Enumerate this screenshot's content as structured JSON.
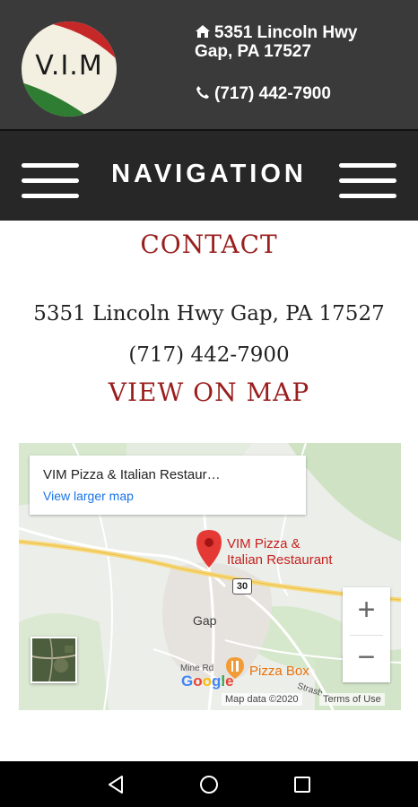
{
  "header": {
    "logo_text": "V.I.M",
    "address_line1": "5351 Lincoln Hwy",
    "address_line2": "Gap, PA 17527",
    "phone": "(717) 442-7900"
  },
  "nav": {
    "label": "NAVIGATION"
  },
  "content": {
    "title": "CONTACT",
    "address": "5351 Lincoln Hwy Gap, PA 17527",
    "phone": "(717) 442-7900",
    "map_link": "VIEW ON MAP"
  },
  "map": {
    "card_title": "VIM Pizza & Italian Restaur…",
    "card_link": "View larger map",
    "pin_label_line1": "VIM Pizza &",
    "pin_label_line2": "Italian Restaurant",
    "town_label": "Gap",
    "route_number": "30",
    "poi_label": "Pizza Box",
    "street_label1": "Mine Rd",
    "street_label2": "Strasb",
    "zoom_in": "+",
    "zoom_out": "−",
    "attribution": "Map data ©2020",
    "terms": "Terms of Use"
  },
  "colors": {
    "accent": "#9a1e1e",
    "topbar_bg": "#3a3a3a",
    "navbar_bg": "#272727",
    "link_blue": "#1a73e8"
  }
}
